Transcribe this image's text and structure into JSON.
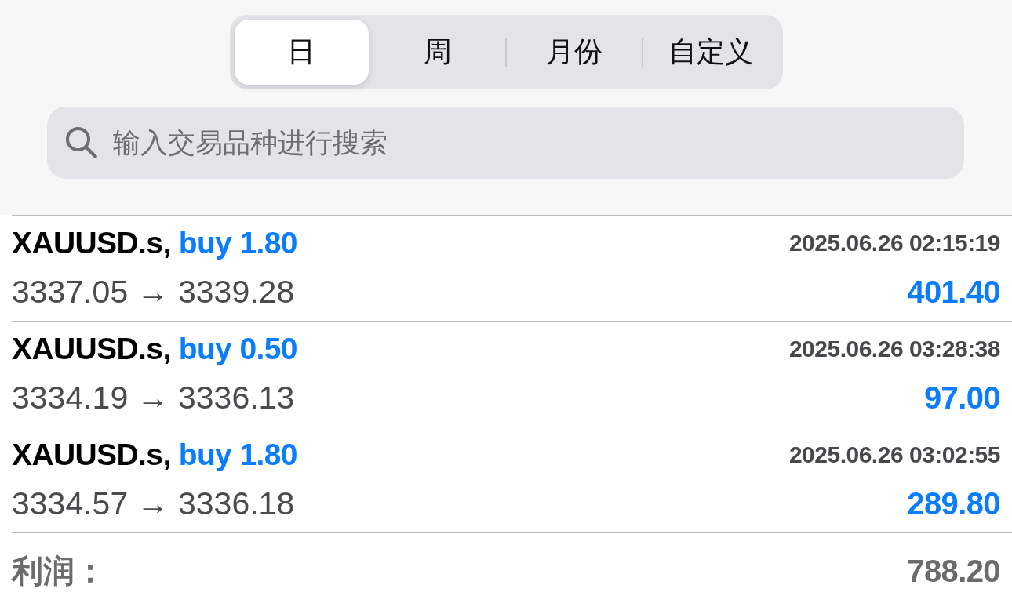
{
  "segments": [
    {
      "label": "日",
      "selected": true
    },
    {
      "label": "周",
      "selected": false
    },
    {
      "label": "月份",
      "selected": false
    },
    {
      "label": "自定义",
      "selected": false
    }
  ],
  "search": {
    "placeholder": "输入交易品种进行搜索"
  },
  "deals": [
    {
      "symbol": "XAUUSD.s,",
      "order": "buy 1.80",
      "time": "2025.06.26 02:15:19",
      "prices": "3337.05 → 3339.28",
      "profit": "401.40"
    },
    {
      "symbol": "XAUUSD.s,",
      "order": "buy 0.50",
      "time": "2025.06.26 03:28:38",
      "prices": "3334.19 → 3336.13",
      "profit": "97.00"
    },
    {
      "symbol": "XAUUSD.s,",
      "order": "buy 1.80",
      "time": "2025.06.26 03:02:55",
      "prices": "3334.57 → 3336.18",
      "profit": "289.80"
    }
  ],
  "total": {
    "label": "利润：",
    "value": "788.20"
  }
}
